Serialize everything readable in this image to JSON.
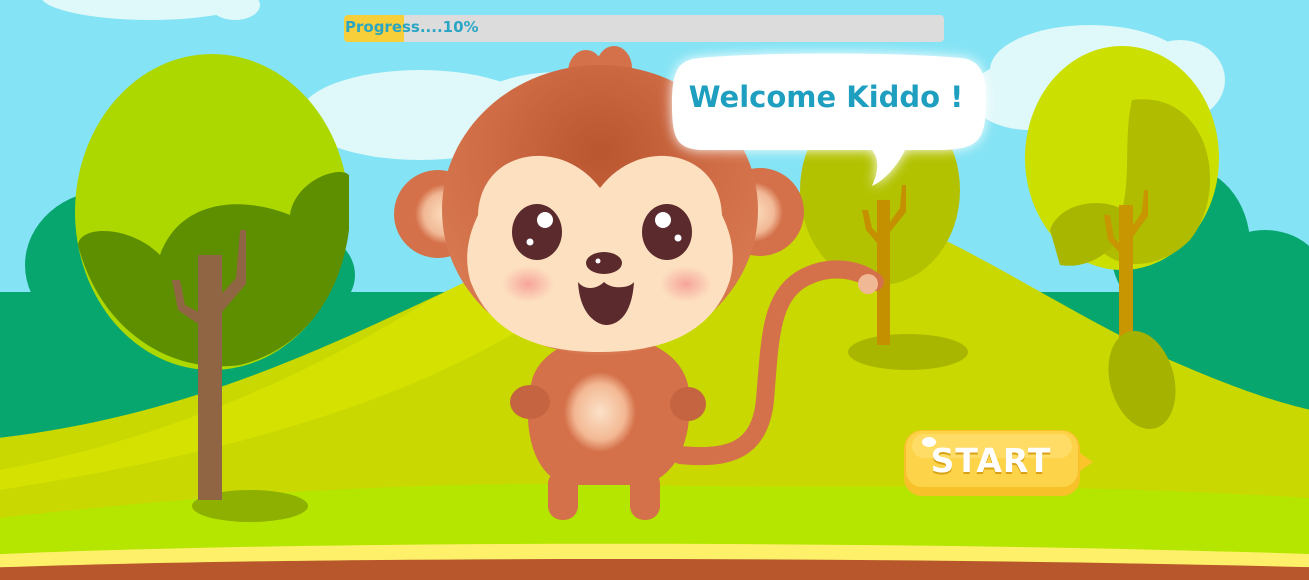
{
  "progress": {
    "label": "Progress....10%",
    "value_percent": 10
  },
  "speech_bubble": {
    "text": "Welcome Kiddo !"
  },
  "start_button": {
    "label": "START"
  },
  "colors": {
    "sky": "#84e3f4",
    "hill": "#c8d800",
    "foreground_grass": "#b4e600",
    "dark_bush": "#06a66e",
    "progress_fill": "#f7cf3a",
    "progress_track": "#dcdcdc",
    "welcome_text": "#1f9fbf",
    "start_button": "#fbc52a",
    "monkey_fur": "#d4714a",
    "monkey_face": "#fde0c0"
  }
}
